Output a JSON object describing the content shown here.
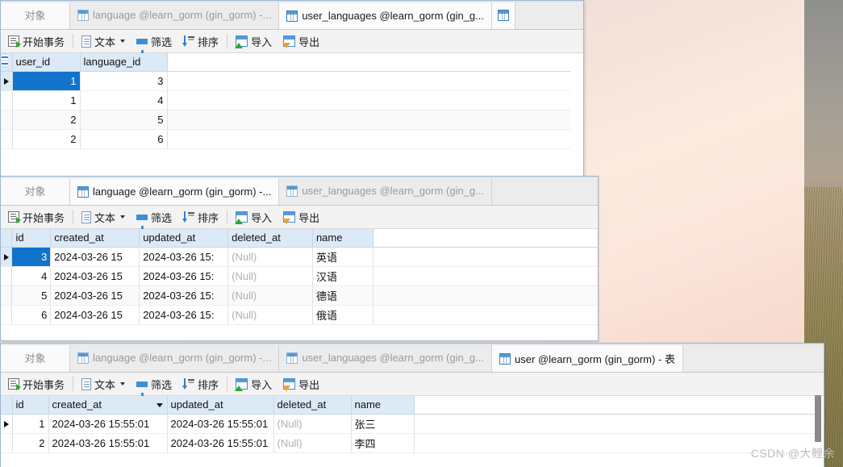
{
  "desktop": {
    "watermark": "CSDN @大鲤余"
  },
  "toolbar": {
    "begin_transaction": "开始事务",
    "text": "文本",
    "filter": "筛选",
    "sort": "排序",
    "import": "导入",
    "export": "导出"
  },
  "windows": [
    {
      "id": "win1",
      "tabs": [
        {
          "label": "对象",
          "icon": "",
          "active": false,
          "kind": "objects"
        },
        {
          "label": "language @learn_gorm (gin_gorm) -...",
          "icon": "grid-icon",
          "active": false,
          "kind": "table"
        },
        {
          "label": "user_languages @learn_gorm (gin_g...",
          "icon": "grid-icon",
          "active": true,
          "kind": "table"
        },
        {
          "label": "",
          "icon": "grid-icon",
          "active": false,
          "kind": "icononly"
        }
      ],
      "grid": {
        "columns": [
          "user_id",
          "language_id"
        ],
        "rows": [
          {
            "marker": true,
            "cells": [
              "1",
              "3"
            ],
            "selected_col": 0
          },
          {
            "marker": false,
            "cells": [
              "1",
              "4"
            ],
            "selected_col": -1
          },
          {
            "marker": false,
            "cells": [
              "2",
              "5"
            ],
            "selected_col": -1
          },
          {
            "marker": false,
            "cells": [
              "2",
              "6"
            ],
            "selected_col": -1
          }
        ]
      }
    },
    {
      "id": "win2",
      "tabs": [
        {
          "label": "对象",
          "icon": "",
          "active": false,
          "kind": "objects"
        },
        {
          "label": "language @learn_gorm (gin_gorm) -...",
          "icon": "grid-icon",
          "active": true,
          "kind": "table"
        },
        {
          "label": "user_languages @learn_gorm (gin_g...",
          "icon": "grid-icon",
          "active": false,
          "kind": "table"
        }
      ],
      "grid": {
        "columns": [
          "id",
          "created_at",
          "updated_at",
          "deleted_at",
          "name"
        ],
        "rows": [
          {
            "marker": true,
            "cells": [
              "3",
              "2024-03-26 15",
              "2024-03-26 15:",
              "(Null)",
              "英语"
            ],
            "selected_col": 0
          },
          {
            "marker": false,
            "cells": [
              "4",
              "2024-03-26 15",
              "2024-03-26 15:",
              "(Null)",
              "汉语"
            ],
            "selected_col": -1
          },
          {
            "marker": false,
            "cells": [
              "5",
              "2024-03-26 15",
              "2024-03-26 15:",
              "(Null)",
              "德语"
            ],
            "selected_col": -1
          },
          {
            "marker": false,
            "cells": [
              "6",
              "2024-03-26 15",
              "2024-03-26 15:",
              "(Null)",
              "俄语"
            ],
            "selected_col": -1
          }
        ]
      }
    },
    {
      "id": "win3",
      "tabs": [
        {
          "label": "对象",
          "icon": "",
          "active": false,
          "kind": "objects"
        },
        {
          "label": "language @learn_gorm (gin_gorm) -...",
          "icon": "grid-icon",
          "active": false,
          "kind": "table"
        },
        {
          "label": "user_languages @learn_gorm (gin_g...",
          "icon": "grid-icon",
          "active": false,
          "kind": "table"
        },
        {
          "label": "user @learn_gorm (gin_gorm) - 表",
          "icon": "grid-icon",
          "active": true,
          "kind": "table"
        }
      ],
      "grid": {
        "columns": [
          "id",
          "created_at",
          "updated_at",
          "deleted_at",
          "name"
        ],
        "sorted_column": "created_at",
        "rows": [
          {
            "marker": true,
            "cells": [
              "1",
              "2024-03-26 15:55:01",
              "2024-03-26 15:55:01",
              "(Null)",
              "张三"
            ],
            "selected_col": -1
          },
          {
            "marker": false,
            "cells": [
              "2",
              "2024-03-26 15:55:01",
              "2024-03-26 15:55:01",
              "(Null)",
              "李四"
            ],
            "selected_col": -1
          }
        ]
      }
    }
  ]
}
